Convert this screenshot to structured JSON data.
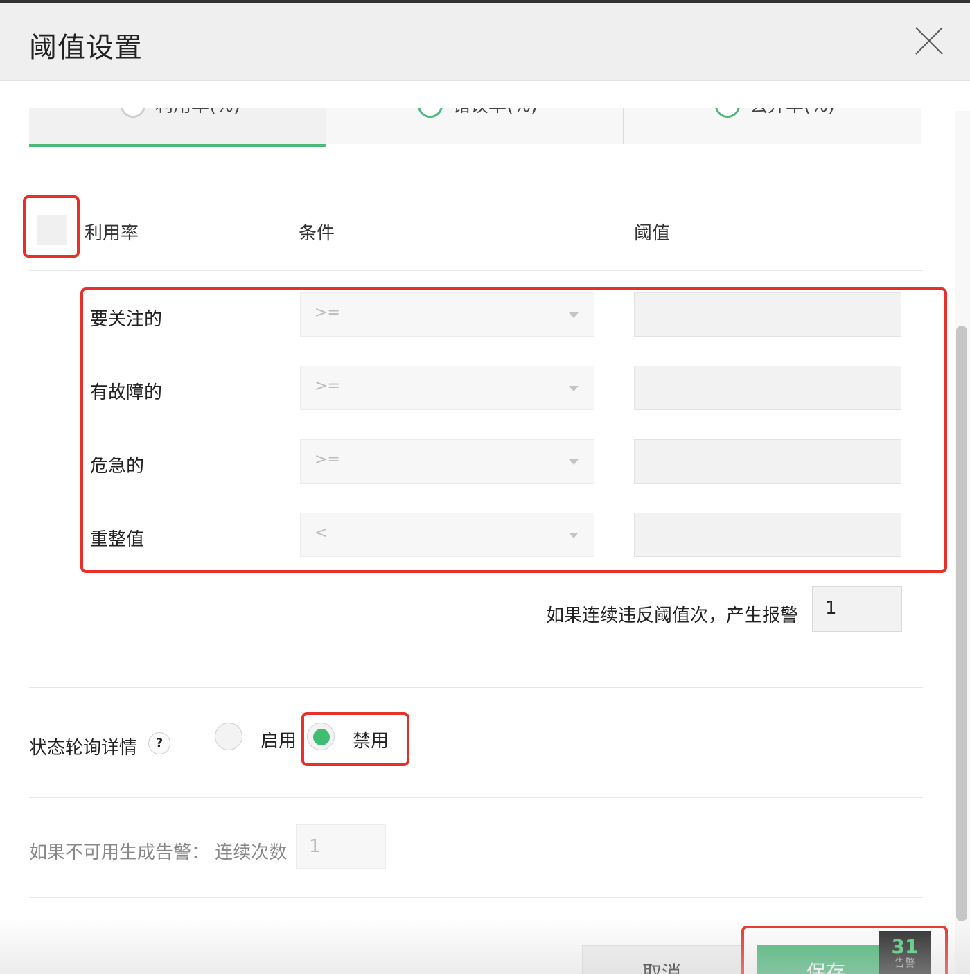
{
  "dialog": {
    "title": "阈值设置"
  },
  "tabs": [
    {
      "label": "利用率(%)",
      "active": true
    },
    {
      "label": "错误率(%)",
      "active": false
    },
    {
      "label": "丢弃率(%)",
      "active": false
    }
  ],
  "table": {
    "col_metric": "利用率",
    "col_condition": "条件",
    "col_threshold": "阈值",
    "rows": [
      {
        "label": "要关注的",
        "condition": ">=",
        "value": ""
      },
      {
        "label": "有故障的",
        "condition": ">=",
        "value": ""
      },
      {
        "label": "危急的",
        "condition": ">=",
        "value": ""
      },
      {
        "label": "重整值",
        "condition": "<",
        "value": ""
      }
    ]
  },
  "repeat": {
    "label": "如果连续违反阈值次，产生报警",
    "value": "1"
  },
  "poll": {
    "label": "状态轮询详情",
    "help": "?",
    "enable_label": "启用",
    "disable_label": "禁用",
    "selected": "禁用"
  },
  "unavailable": {
    "label": "如果不可用生成告警：  连续次数",
    "value": "1"
  },
  "footer": {
    "cancel_label": "取消",
    "save_label": "保存"
  },
  "alarm_badge": {
    "count": "31",
    "label": "告警"
  },
  "colors": {
    "accent_green": "#4cb87a",
    "highlight_red": "#e8302a"
  }
}
